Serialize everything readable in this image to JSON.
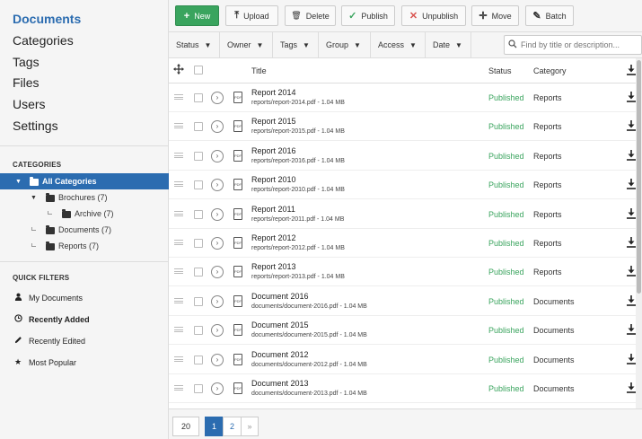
{
  "sidebar": {
    "menu": [
      "Documents",
      "Categories",
      "Tags",
      "Files",
      "Users",
      "Settings"
    ],
    "categories_heading": "CATEGORIES",
    "categories": [
      {
        "label": "All Categories"
      },
      {
        "label": "Brochures (7)"
      },
      {
        "label": "Archive (7)"
      },
      {
        "label": "Documents (7)"
      },
      {
        "label": "Reports (7)"
      }
    ],
    "quick_filters_heading": "QUICK FILTERS",
    "quick_filters": [
      {
        "label": "My Documents",
        "icon": "user-icon"
      },
      {
        "label": "Recently Added",
        "icon": "clock-icon"
      },
      {
        "label": "Recently Edited",
        "icon": "pencil-icon"
      },
      {
        "label": "Most Popular",
        "icon": "star-icon"
      }
    ]
  },
  "toolbar": {
    "new": "New",
    "upload": "Upload",
    "delete": "Delete",
    "publish": "Publish",
    "unpublish": "Unpublish",
    "move": "Move",
    "batch": "Batch"
  },
  "filters": {
    "status": "Status",
    "owner": "Owner",
    "tags": "Tags",
    "group": "Group",
    "access": "Access",
    "date": "Date"
  },
  "search": {
    "placeholder": "Find by title or description..."
  },
  "table": {
    "headers": {
      "title": "Title",
      "status": "Status",
      "category": "Category"
    },
    "rows": [
      {
        "title": "Report 2014",
        "path": "reports/report-2014.pdf - 1.04 MB",
        "status": "Published",
        "category": "Reports"
      },
      {
        "title": "Report 2015",
        "path": "reports/report-2015.pdf - 1.04 MB",
        "status": "Published",
        "category": "Reports"
      },
      {
        "title": "Report 2016",
        "path": "reports/report-2016.pdf - 1.04 MB",
        "status": "Published",
        "category": "Reports"
      },
      {
        "title": "Report 2010",
        "path": "reports/report-2010.pdf - 1.04 MB",
        "status": "Published",
        "category": "Reports"
      },
      {
        "title": "Report 2011",
        "path": "reports/report-2011.pdf - 1.04 MB",
        "status": "Published",
        "category": "Reports"
      },
      {
        "title": "Report 2012",
        "path": "reports/report-2012.pdf - 1.04 MB",
        "status": "Published",
        "category": "Reports"
      },
      {
        "title": "Report 2013",
        "path": "reports/report-2013.pdf - 1.04 MB",
        "status": "Published",
        "category": "Reports"
      },
      {
        "title": "Document 2016",
        "path": "documents/document-2016.pdf - 1.04 MB",
        "status": "Published",
        "category": "Documents"
      },
      {
        "title": "Document 2015",
        "path": "documents/document-2015.pdf - 1.04 MB",
        "status": "Published",
        "category": "Documents"
      },
      {
        "title": "Document 2012",
        "path": "documents/document-2012.pdf - 1.04 MB",
        "status": "Published",
        "category": "Documents"
      },
      {
        "title": "Document 2013",
        "path": "documents/document-2013.pdf - 1.04 MB",
        "status": "Published",
        "category": "Documents"
      }
    ]
  },
  "pagination": {
    "page_size": "20",
    "pages": [
      "1",
      "2"
    ],
    "next": "»",
    "current": "1"
  },
  "colors": {
    "accent": "#2b6cb0",
    "published": "#3aa45e",
    "new_button": "#3aa45e"
  }
}
